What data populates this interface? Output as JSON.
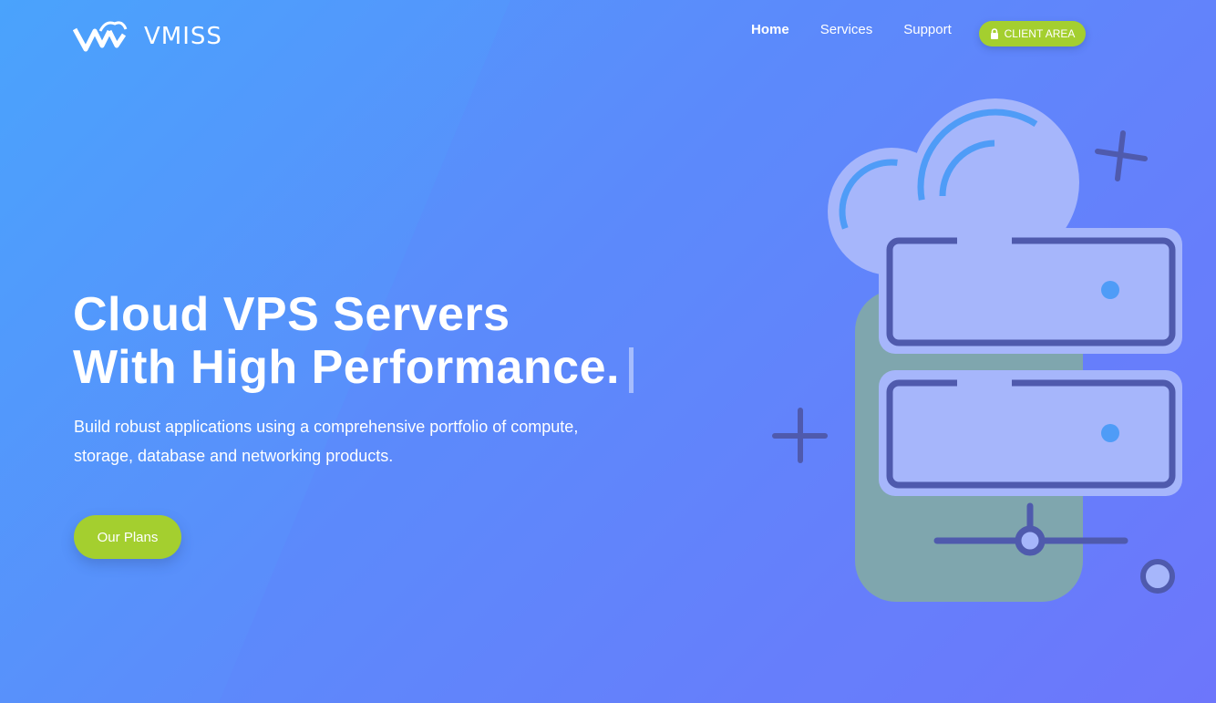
{
  "brand": {
    "name": "VMISS"
  },
  "nav": {
    "items": [
      {
        "label": "Home",
        "active": true
      },
      {
        "label": "Services",
        "active": false
      },
      {
        "label": "Support",
        "active": false
      }
    ],
    "client_area": {
      "label": "CLIENT AREA",
      "icon": "lock-icon"
    }
  },
  "hero": {
    "title_line1": "Cloud VPS Servers",
    "title_line2": "With High Performance.",
    "description": "Build robust applications using a comprehensive portfolio of compute, storage, database and networking products.",
    "cta_label": "Our Plans"
  },
  "illustration": {
    "icon": "cloud-server-illustration"
  },
  "colors": {
    "accent_green": "#a4cf2f",
    "gradient_start": "#4aa3fc",
    "gradient_end": "#6d78fb",
    "illustration_outline": "#4f5aad",
    "illustration_fill": "#a3b4fb"
  }
}
